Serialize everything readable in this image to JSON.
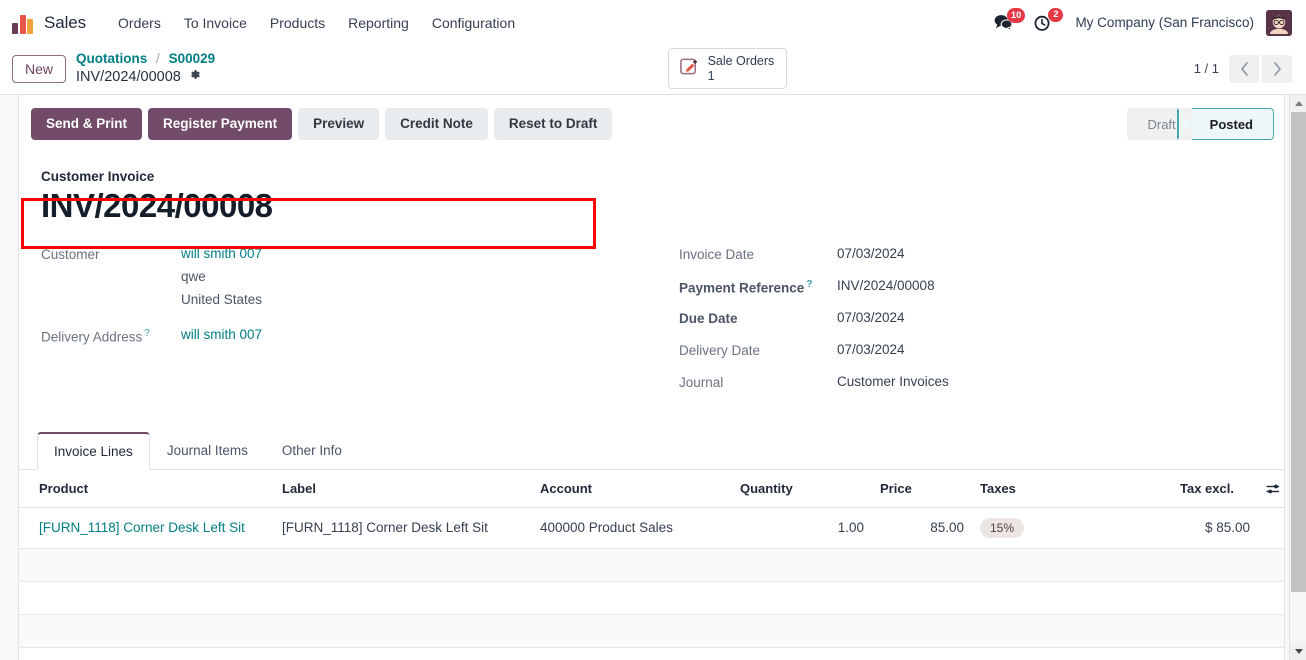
{
  "navbar": {
    "app_name": "Sales",
    "menu": [
      {
        "label": "Orders"
      },
      {
        "label": "To Invoice"
      },
      {
        "label": "Products"
      },
      {
        "label": "Reporting"
      },
      {
        "label": "Configuration"
      }
    ],
    "messages_icon": "chat-bubble-icon",
    "messages_count": "10",
    "activities_icon": "clock-icon",
    "activities_count": "2",
    "company": "My Company (San Francisco)",
    "avatar": "user-avatar"
  },
  "control_panel": {
    "new_label": "New",
    "breadcrumb": {
      "parent": "Quotations",
      "separator": "/",
      "record": "S00029",
      "current": "INV/2024/00008",
      "settings_icon": "gear-icon"
    },
    "stat_button": {
      "icon": "pencil-square-icon",
      "label": "Sale Orders",
      "value": "1"
    },
    "pager": {
      "count": "1 / 1",
      "prev_icon": "chevron-left-icon",
      "next_icon": "chevron-right-icon"
    }
  },
  "statusbar": {
    "buttons": [
      {
        "label": "Send & Print",
        "style": "primary"
      },
      {
        "label": "Register Payment",
        "style": "primary"
      },
      {
        "label": "Preview",
        "style": "secondary"
      },
      {
        "label": "Credit Note",
        "style": "secondary"
      },
      {
        "label": "Reset to Draft",
        "style": "secondary"
      }
    ],
    "stages": [
      {
        "label": "Draft",
        "active": false
      },
      {
        "label": "Posted",
        "active": true
      }
    ],
    "highlight_color": "#ff0000"
  },
  "form": {
    "subtitle": "Customer Invoice",
    "title": "INV/2024/00008",
    "left_fields": [
      {
        "label": "Customer",
        "bold": false,
        "help": false,
        "value": "will smith 007",
        "link": true,
        "extra_lines": [
          "qwe",
          "United States"
        ]
      },
      {
        "label": "Delivery Address",
        "bold": false,
        "help": true,
        "value": "will smith 007",
        "link": true,
        "extra_lines": []
      }
    ],
    "right_fields": [
      {
        "label": "Invoice Date",
        "bold": false,
        "help": false,
        "value": "07/03/2024"
      },
      {
        "label": "Payment Reference",
        "bold": true,
        "help": true,
        "value": "INV/2024/00008"
      },
      {
        "label": "Due Date",
        "bold": true,
        "help": false,
        "value": "07/03/2024"
      },
      {
        "label": "Delivery Date",
        "bold": false,
        "help": false,
        "value": "07/03/2024"
      },
      {
        "label": "Journal",
        "bold": false,
        "help": false,
        "value": "Customer Invoices"
      }
    ]
  },
  "notebook": {
    "tabs": [
      {
        "label": "Invoice Lines",
        "active": true
      },
      {
        "label": "Journal Items",
        "active": false
      },
      {
        "label": "Other Info",
        "active": false
      }
    ]
  },
  "lines_table": {
    "columns": {
      "product": "Product",
      "label": "Label",
      "account": "Account",
      "quantity": "Quantity",
      "price": "Price",
      "taxes": "Taxes",
      "tax_excl": "Tax excl.",
      "options_icon": "column-options-icon"
    },
    "rows": [
      {
        "product": "[FURN_1118] Corner Desk Left Sit",
        "label": "[FURN_1118] Corner Desk Left Sit",
        "account": "400000 Product Sales",
        "quantity": "1.00",
        "price": "85.00",
        "taxes": "15%",
        "tax_excl": "$ 85.00"
      }
    ],
    "empty_rows": 3
  },
  "scrollbar": {
    "up_icon": "scroll-up-arrow-icon",
    "down_icon": "scroll-down-arrow-icon",
    "thumb": "scrollbar-thumb"
  }
}
